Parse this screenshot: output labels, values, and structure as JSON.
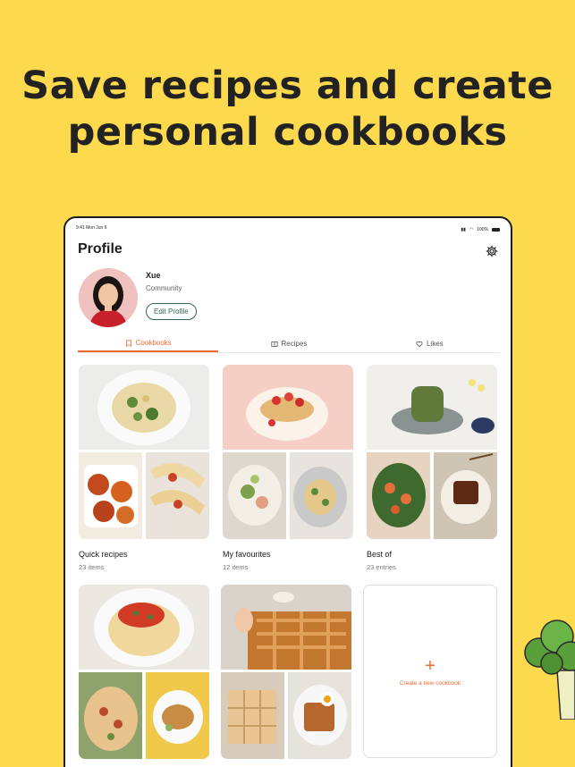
{
  "headline": {
    "line1": "Save recipes and create",
    "line2": "personal cookbooks"
  },
  "status_bar": {
    "time": "9:41",
    "date": "Mon Jun 6",
    "battery": "100%"
  },
  "profile": {
    "title": "Profile",
    "name": "Xue",
    "role": "Community",
    "edit_label": "Edit Profile"
  },
  "tabs": [
    {
      "label": "Cookbooks",
      "icon": "bookmark-icon",
      "active": true
    },
    {
      "label": "Recipes",
      "icon": "recipe-book-icon",
      "active": false
    },
    {
      "label": "Likes",
      "icon": "heart-icon",
      "active": false
    }
  ],
  "cookbooks": [
    {
      "title": "Quick recipes",
      "count": "23 items"
    },
    {
      "title": "My favourites",
      "count": "12 items"
    },
    {
      "title": "Best of",
      "count": "23 entries"
    },
    {
      "title": "",
      "count": ""
    },
    {
      "title": "",
      "count": ""
    }
  ],
  "new_cookbook": {
    "label": "Create a new cookbook"
  },
  "colors": {
    "accent": "#ee6a2d",
    "background": "#FDD94E",
    "edit_border": "#2f6a56"
  }
}
